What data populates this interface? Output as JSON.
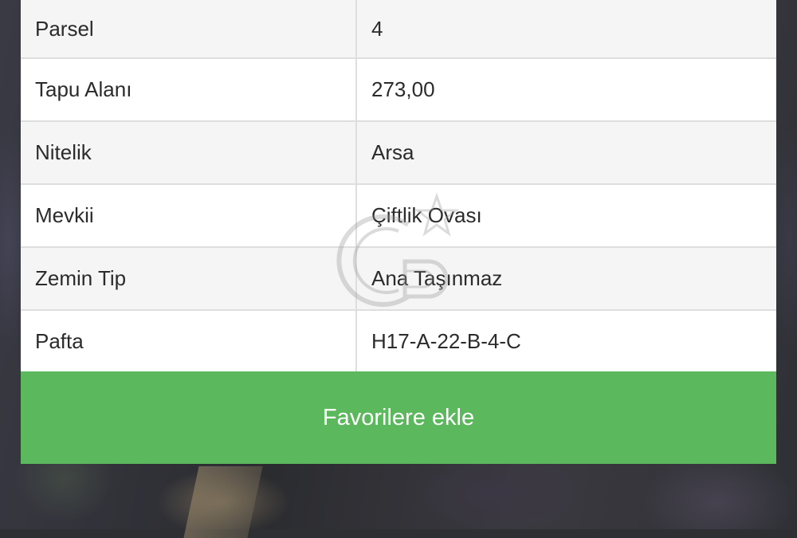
{
  "details": {
    "rows": [
      {
        "label": "Parsel",
        "value": "4"
      },
      {
        "label": "Tapu Alanı",
        "value": "273,00"
      },
      {
        "label": "Nitelik",
        "value": "Arsa"
      },
      {
        "label": "Mevkii",
        "value": "Çiftlik Ovası"
      },
      {
        "label": "Zemin Tip",
        "value": "Ana Taşınmaz"
      },
      {
        "label": "Pafta",
        "value": "H17-A-22-B-4-C"
      }
    ]
  },
  "actions": {
    "favorite_label": "Favorilere ekle",
    "favorite_color": "#5cb85c"
  },
  "watermark": {
    "icon": "cb-logo-icon"
  }
}
